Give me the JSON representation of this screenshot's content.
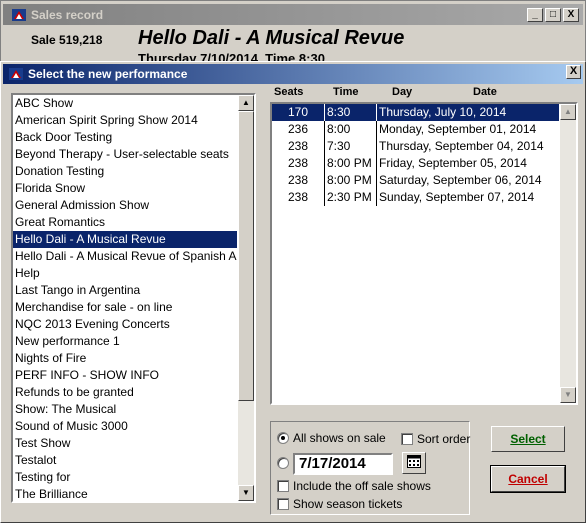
{
  "background_window": {
    "title": "Sales record",
    "sale_label": "Sale 519,218",
    "show_heading": "Hello Dali - A Musical Revue",
    "show_subheading": "Thursday 7/10/2014, Time 8:30",
    "minimize_label": "_",
    "maximize_label": "□",
    "close_label": "X"
  },
  "dialog": {
    "title": "Select the new performance",
    "close_label": "X"
  },
  "shows": [
    "ABC Show",
    "American Spirit Spring Show 2014",
    "Back Door Testing",
    "Beyond Therapy - User-selectable seats",
    "Donation Testing",
    "Florida Snow",
    "General Admission Show",
    "Great Romantics",
    "Hello Dali - A Musical Revue",
    "Hello Dali - A Musical Revue of Spanish Art",
    "Help",
    "Last Tango in Argentina",
    "Merchandise for sale - on line",
    "NQC 2013 Evening Concerts",
    "New performance 1",
    "Nights of Fire",
    "PERF INFO - SHOW INFO",
    "Refunds to be granted",
    "Show: The Musical",
    "Sound of Music 3000",
    "Test Show",
    "Testalot",
    "Testing for",
    "The Brilliance"
  ],
  "selected_show_index": 8,
  "performance_table": {
    "headers": {
      "seats": "Seats",
      "time": "Time",
      "day": "Day",
      "date": "Date"
    },
    "rows": [
      {
        "seats": "170",
        "time": "8:30",
        "day_date": "Thursday, July 10, 2014"
      },
      {
        "seats": "236",
        "time": "8:00",
        "day_date": "Monday, September 01, 2014"
      },
      {
        "seats": "238",
        "time": "7:30",
        "day_date": "Thursday, September 04, 2014"
      },
      {
        "seats": "238",
        "time": "8:00 PM",
        "day_date": "Friday, September 05, 2014"
      },
      {
        "seats": "238",
        "time": "8:00 PM",
        "day_date": "Saturday, September 06, 2014"
      },
      {
        "seats": "238",
        "time": "2:30 PM",
        "day_date": "Sunday, September 07, 2014"
      }
    ],
    "selected_row_index": 0
  },
  "options": {
    "all_shows_label": "All shows on sale",
    "all_shows_selected": true,
    "sort_order_label": "Sort order",
    "sort_order_checked": false,
    "date_value": "7/17/2014",
    "date_selected": false,
    "include_off_sale_label": "Include the off sale shows",
    "include_off_sale_checked": false,
    "show_season_label": "Show season tickets",
    "show_season_checked": false
  },
  "buttons": {
    "select_label": "Select",
    "cancel_label": "Cancel"
  },
  "colors": {
    "selection": "#0a246a",
    "select_text": "#006000",
    "cancel_text": "#c00000"
  },
  "icons": {
    "app": "app-flag-icon",
    "calendar": "calendar-icon",
    "scroll_up": "scroll-up-arrow-icon",
    "scroll_down": "scroll-down-arrow-icon"
  }
}
